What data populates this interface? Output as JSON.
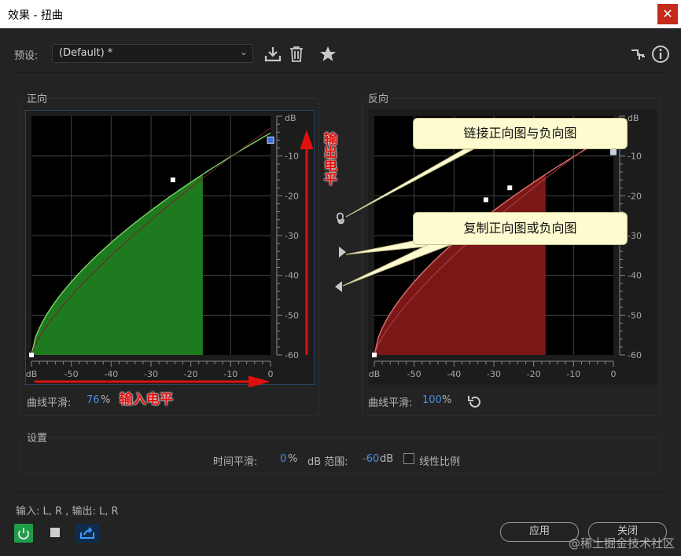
{
  "window": {
    "title": "效果 - 扭曲",
    "close_glyph": "✕"
  },
  "toolbar": {
    "presets_label": "预设:",
    "preset_value": "(Default) *",
    "icons": [
      "download-preset-icon",
      "trash-icon",
      "star-icon",
      "routing-icon",
      "info-icon"
    ]
  },
  "forward": {
    "label": "正向",
    "smooth_label": "曲线平滑:",
    "smooth_value": "76",
    "smooth_unit": "%",
    "fill_color": "#1e7a1e",
    "curve_color": "#7cd36a"
  },
  "reverse": {
    "label": "反向",
    "smooth_label": "曲线平滑:",
    "smooth_value": "100",
    "smooth_unit": "%",
    "fill_color": "#7a1818",
    "curve_color": "#e07070"
  },
  "axes": {
    "x_unit": "dB",
    "y_unit": "dB",
    "x_ticks": [
      "-50",
      "-40",
      "-30",
      "-20",
      "-10",
      "0"
    ],
    "y_ticks": [
      "-10",
      "-20",
      "-30",
      "-40",
      "-50",
      "-60"
    ]
  },
  "settings": {
    "label": "设置",
    "time_smooth_label": "时间平滑:",
    "time_smooth_value": "0",
    "time_smooth_unit": "%",
    "db_range_label": "dB 范围:",
    "db_range_value": "-60",
    "db_range_unit": "dB",
    "linear_label": "线性比例"
  },
  "footer": {
    "io_text": "输入: L, R , 输出: L, R",
    "apply_label": "应用",
    "close_label": "关闭"
  },
  "annotations": {
    "link_callout": "链接正向图与负向图",
    "copy_callout": "复制正向图或负向图",
    "output_level": "输出电平",
    "input_level": "输入电平"
  },
  "watermark": "@稀土掘金技术社区"
}
